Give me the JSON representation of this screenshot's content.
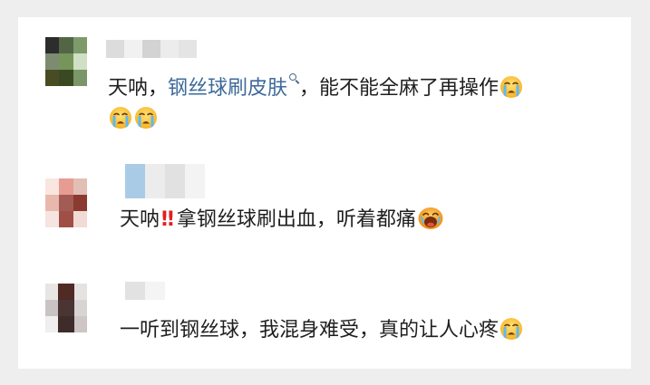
{
  "comments": [
    {
      "text_pre": "天呐，",
      "link_text": "钢丝球刷皮肤",
      "text_post": "，能不能全麻了再操作",
      "avatar_colors": [
        "#2d2d2d",
        "#526646",
        "#7e9a6a",
        "#7d8c70",
        "#75955a",
        "#cfe0c4",
        "#484c23",
        "#3b4922",
        "#7b9668"
      ],
      "nick_colors": [
        "#dcdcdc",
        "#f1f1f1",
        "#d3d3d3",
        "#ececec",
        "#e4e4e4"
      ],
      "emoji": [
        "loudly-crying-emoji",
        "loudly-crying-emoji",
        "loudly-crying-emoji"
      ]
    },
    {
      "text_pre": "天呐",
      "exclaim": "‼",
      "text_post": "拿钢丝球刷出血，听着都痛",
      "avatar_colors": [
        "#fbe5df",
        "#e69b93",
        "#e2bfb4",
        "#e9b8ac",
        "#a25b55",
        "#8a3a2f",
        "#f5e4e0",
        "#a04f47",
        "#f2dbd5"
      ],
      "nick_colors": [
        "#aacbe6",
        "#ececec",
        "#e1e1e1",
        "#f3f3f3"
      ],
      "emoji": [
        "crying-face-emoji"
      ]
    },
    {
      "text": "一听到钢丝球，我混身难受，真的让人心疼",
      "avatar_colors": [
        "#e8e6e4",
        "#502a24",
        "#e5e3e2",
        "#c9c3c3",
        "#4b3434",
        "#d9d4d4",
        "#f0eeee",
        "#3e2c2b",
        "#cdc6c5"
      ],
      "nick_colors": [
        "#e2e2e2",
        "#f4f4f4"
      ],
      "emoji": [
        "loudly-crying-emoji"
      ]
    }
  ]
}
